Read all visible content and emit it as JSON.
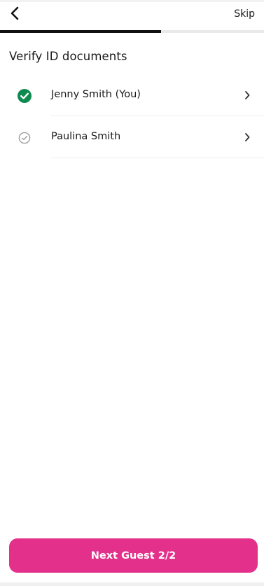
{
  "header": {
    "back_icon": "chevron-left-icon",
    "skip_label": "Skip"
  },
  "progress": {
    "fraction": 0.61
  },
  "section": {
    "title": "Verify ID documents"
  },
  "guests": [
    {
      "name": "Jenny Smith (You)",
      "status": "verified",
      "status_icon": "check-circle-filled-icon",
      "chevron_icon": "chevron-right-icon"
    },
    {
      "name": "Paulina Smith",
      "status": "pending",
      "status_icon": "check-circle-outline-icon",
      "chevron_icon": "chevron-right-icon"
    }
  ],
  "footer": {
    "next_label": "Next Guest 2/2"
  },
  "colors": {
    "accent": "#e3308b",
    "verified": "#0f8a4f",
    "pending": "#9e9e9e",
    "progress_fill": "#111111",
    "progress_track": "#e9e9e9"
  }
}
